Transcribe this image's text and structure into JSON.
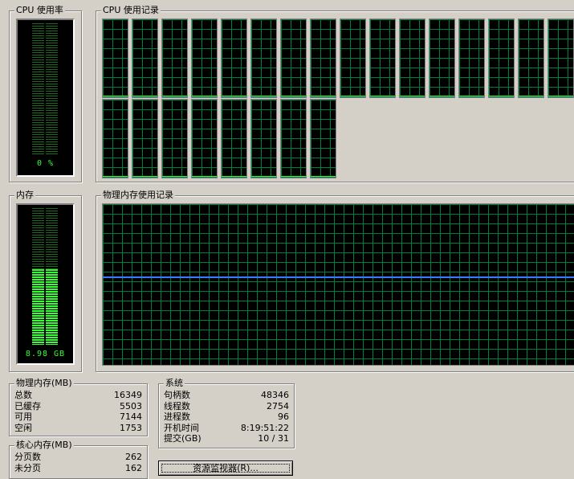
{
  "cpu_usage": {
    "title": "CPU 使用率",
    "value": "0 %",
    "level": 0
  },
  "cpu_history": {
    "title": "CPU 使用记录",
    "core_count": 24
  },
  "memory": {
    "title": "内存",
    "value": "8.98 GB",
    "level": 0.55
  },
  "memory_history": {
    "title": "物理内存使用记录",
    "level": 0.55
  },
  "physical_memory": {
    "title": "物理内存(MB)",
    "rows": [
      {
        "label": "总数",
        "value": "16349"
      },
      {
        "label": "已缓存",
        "value": "5503"
      },
      {
        "label": "可用",
        "value": "7144"
      },
      {
        "label": "空闲",
        "value": "1753"
      }
    ]
  },
  "kernel_memory": {
    "title": "核心内存(MB)",
    "rows": [
      {
        "label": "分页数",
        "value": "262"
      },
      {
        "label": "未分页",
        "value": "162"
      }
    ]
  },
  "system": {
    "title": "系统",
    "rows": [
      {
        "label": "句柄数",
        "value": "48346"
      },
      {
        "label": "线程数",
        "value": "2754"
      },
      {
        "label": "进程数",
        "value": "96"
      },
      {
        "label": "开机时间",
        "value": "8:19:51:22"
      },
      {
        "label": "提交(GB)",
        "value": "10 / 31"
      }
    ]
  },
  "resource_monitor_button": {
    "label": "资源监视器(R)..."
  },
  "colors": {
    "graph_grid": "#008040",
    "meter_green": "#33ff33",
    "memory_line": "#3a7bff",
    "background": "#d4d0c8"
  }
}
